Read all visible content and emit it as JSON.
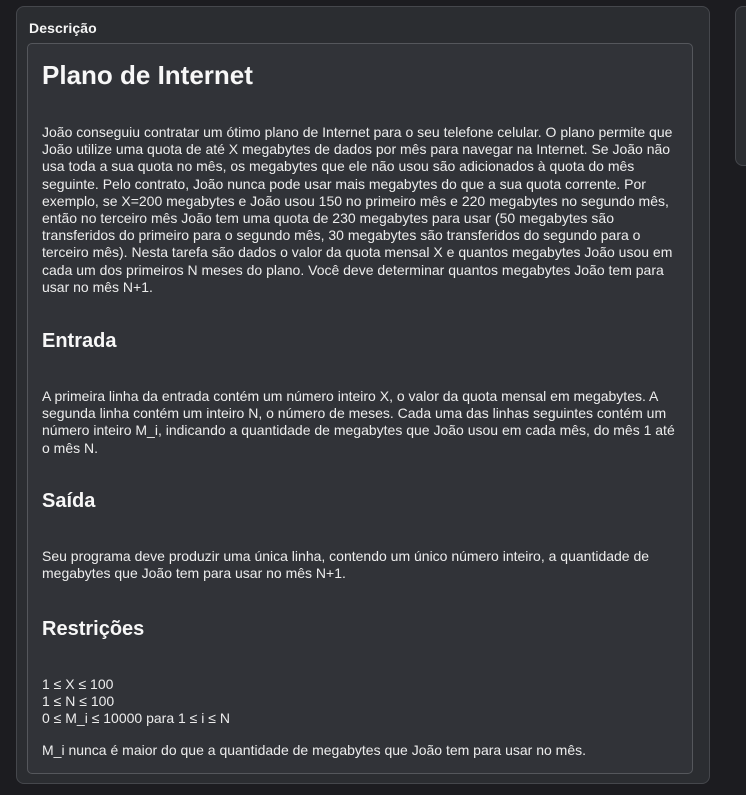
{
  "panel": {
    "title": "Descrição"
  },
  "problem": {
    "title": "Plano de Internet",
    "statement": "João conseguiu contratar um ótimo plano de Internet para o seu telefone celular. O plano permite que João utilize uma quota de até X megabytes de dados por mês para navegar na Internet. Se João não usa toda a sua quota no mês, os megabytes que ele não usou são adicionados à quota do mês seguinte. Pelo contrato, João nunca pode usar mais megabytes do que a sua quota corrente. Por exemplo, se X=200 megabytes e João usou 150 no primeiro mês e 220 megabytes no segundo mês, então no terceiro mês João tem uma quota de 230 megabytes para usar (50 megabytes são transferidos do primeiro para o segundo mês, 30 megabytes são transferidos do segundo para o terceiro mês). Nesta tarefa são dados o valor da quota mensal X e quantos megabytes João usou em cada um dos primeiros N meses do plano. Você deve determinar quantos megabytes João tem para usar no mês N+1.",
    "input_heading": "Entrada",
    "input_text": "A primeira linha da entrada contém um número inteiro X, o valor da quota mensal em megabytes. A segunda linha contém um inteiro N, o número de meses. Cada uma das linhas seguintes contém um número inteiro M_i, indicando a quantidade de megabytes que João usou em cada mês, do mês 1 até o mês N.",
    "output_heading": "Saída",
    "output_text": "Seu programa deve produzir uma única linha, contendo um único número inteiro, a quantidade de megabytes que João tem para usar no mês N+1.",
    "constraints_heading": "Restrições",
    "constraints": [
      "1 ≤ X ≤ 100",
      "1 ≤ N ≤ 100",
      "0 ≤ M_i ≤ 10000 para 1 ≤ i ≤ N"
    ],
    "constraints_note": "M_i nunca é maior do que a quantidade de megabytes que João tem para usar no mês."
  }
}
